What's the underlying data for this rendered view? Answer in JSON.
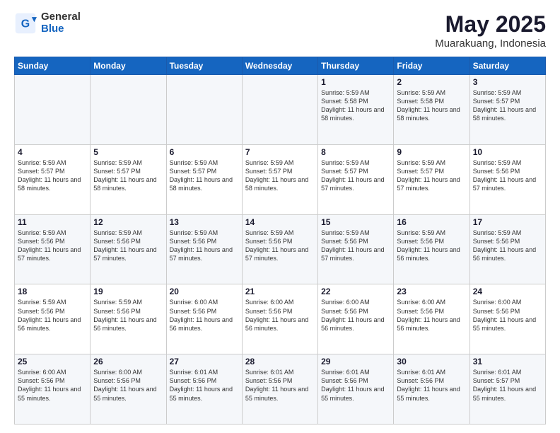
{
  "header": {
    "logo_general": "General",
    "logo_blue": "Blue",
    "title": "May 2025",
    "subtitle": "Muarakuang, Indonesia"
  },
  "days_of_week": [
    "Sunday",
    "Monday",
    "Tuesday",
    "Wednesday",
    "Thursday",
    "Friday",
    "Saturday"
  ],
  "weeks": [
    [
      {
        "num": "",
        "info": ""
      },
      {
        "num": "",
        "info": ""
      },
      {
        "num": "",
        "info": ""
      },
      {
        "num": "",
        "info": ""
      },
      {
        "num": "1",
        "info": "Sunrise: 5:59 AM\nSunset: 5:58 PM\nDaylight: 11 hours\nand 58 minutes."
      },
      {
        "num": "2",
        "info": "Sunrise: 5:59 AM\nSunset: 5:58 PM\nDaylight: 11 hours\nand 58 minutes."
      },
      {
        "num": "3",
        "info": "Sunrise: 5:59 AM\nSunset: 5:57 PM\nDaylight: 11 hours\nand 58 minutes."
      }
    ],
    [
      {
        "num": "4",
        "info": "Sunrise: 5:59 AM\nSunset: 5:57 PM\nDaylight: 11 hours\nand 58 minutes."
      },
      {
        "num": "5",
        "info": "Sunrise: 5:59 AM\nSunset: 5:57 PM\nDaylight: 11 hours\nand 58 minutes."
      },
      {
        "num": "6",
        "info": "Sunrise: 5:59 AM\nSunset: 5:57 PM\nDaylight: 11 hours\nand 58 minutes."
      },
      {
        "num": "7",
        "info": "Sunrise: 5:59 AM\nSunset: 5:57 PM\nDaylight: 11 hours\nand 58 minutes."
      },
      {
        "num": "8",
        "info": "Sunrise: 5:59 AM\nSunset: 5:57 PM\nDaylight: 11 hours\nand 57 minutes."
      },
      {
        "num": "9",
        "info": "Sunrise: 5:59 AM\nSunset: 5:57 PM\nDaylight: 11 hours\nand 57 minutes."
      },
      {
        "num": "10",
        "info": "Sunrise: 5:59 AM\nSunset: 5:56 PM\nDaylight: 11 hours\nand 57 minutes."
      }
    ],
    [
      {
        "num": "11",
        "info": "Sunrise: 5:59 AM\nSunset: 5:56 PM\nDaylight: 11 hours\nand 57 minutes."
      },
      {
        "num": "12",
        "info": "Sunrise: 5:59 AM\nSunset: 5:56 PM\nDaylight: 11 hours\nand 57 minutes."
      },
      {
        "num": "13",
        "info": "Sunrise: 5:59 AM\nSunset: 5:56 PM\nDaylight: 11 hours\nand 57 minutes."
      },
      {
        "num": "14",
        "info": "Sunrise: 5:59 AM\nSunset: 5:56 PM\nDaylight: 11 hours\nand 57 minutes."
      },
      {
        "num": "15",
        "info": "Sunrise: 5:59 AM\nSunset: 5:56 PM\nDaylight: 11 hours\nand 57 minutes."
      },
      {
        "num": "16",
        "info": "Sunrise: 5:59 AM\nSunset: 5:56 PM\nDaylight: 11 hours\nand 56 minutes."
      },
      {
        "num": "17",
        "info": "Sunrise: 5:59 AM\nSunset: 5:56 PM\nDaylight: 11 hours\nand 56 minutes."
      }
    ],
    [
      {
        "num": "18",
        "info": "Sunrise: 5:59 AM\nSunset: 5:56 PM\nDaylight: 11 hours\nand 56 minutes."
      },
      {
        "num": "19",
        "info": "Sunrise: 5:59 AM\nSunset: 5:56 PM\nDaylight: 11 hours\nand 56 minutes."
      },
      {
        "num": "20",
        "info": "Sunrise: 6:00 AM\nSunset: 5:56 PM\nDaylight: 11 hours\nand 56 minutes."
      },
      {
        "num": "21",
        "info": "Sunrise: 6:00 AM\nSunset: 5:56 PM\nDaylight: 11 hours\nand 56 minutes."
      },
      {
        "num": "22",
        "info": "Sunrise: 6:00 AM\nSunset: 5:56 PM\nDaylight: 11 hours\nand 56 minutes."
      },
      {
        "num": "23",
        "info": "Sunrise: 6:00 AM\nSunset: 5:56 PM\nDaylight: 11 hours\nand 56 minutes."
      },
      {
        "num": "24",
        "info": "Sunrise: 6:00 AM\nSunset: 5:56 PM\nDaylight: 11 hours\nand 55 minutes."
      }
    ],
    [
      {
        "num": "25",
        "info": "Sunrise: 6:00 AM\nSunset: 5:56 PM\nDaylight: 11 hours\nand 55 minutes."
      },
      {
        "num": "26",
        "info": "Sunrise: 6:00 AM\nSunset: 5:56 PM\nDaylight: 11 hours\nand 55 minutes."
      },
      {
        "num": "27",
        "info": "Sunrise: 6:01 AM\nSunset: 5:56 PM\nDaylight: 11 hours\nand 55 minutes."
      },
      {
        "num": "28",
        "info": "Sunrise: 6:01 AM\nSunset: 5:56 PM\nDaylight: 11 hours\nand 55 minutes."
      },
      {
        "num": "29",
        "info": "Sunrise: 6:01 AM\nSunset: 5:56 PM\nDaylight: 11 hours\nand 55 minutes."
      },
      {
        "num": "30",
        "info": "Sunrise: 6:01 AM\nSunset: 5:56 PM\nDaylight: 11 hours\nand 55 minutes."
      },
      {
        "num": "31",
        "info": "Sunrise: 6:01 AM\nSunset: 5:57 PM\nDaylight: 11 hours\nand 55 minutes."
      }
    ]
  ]
}
